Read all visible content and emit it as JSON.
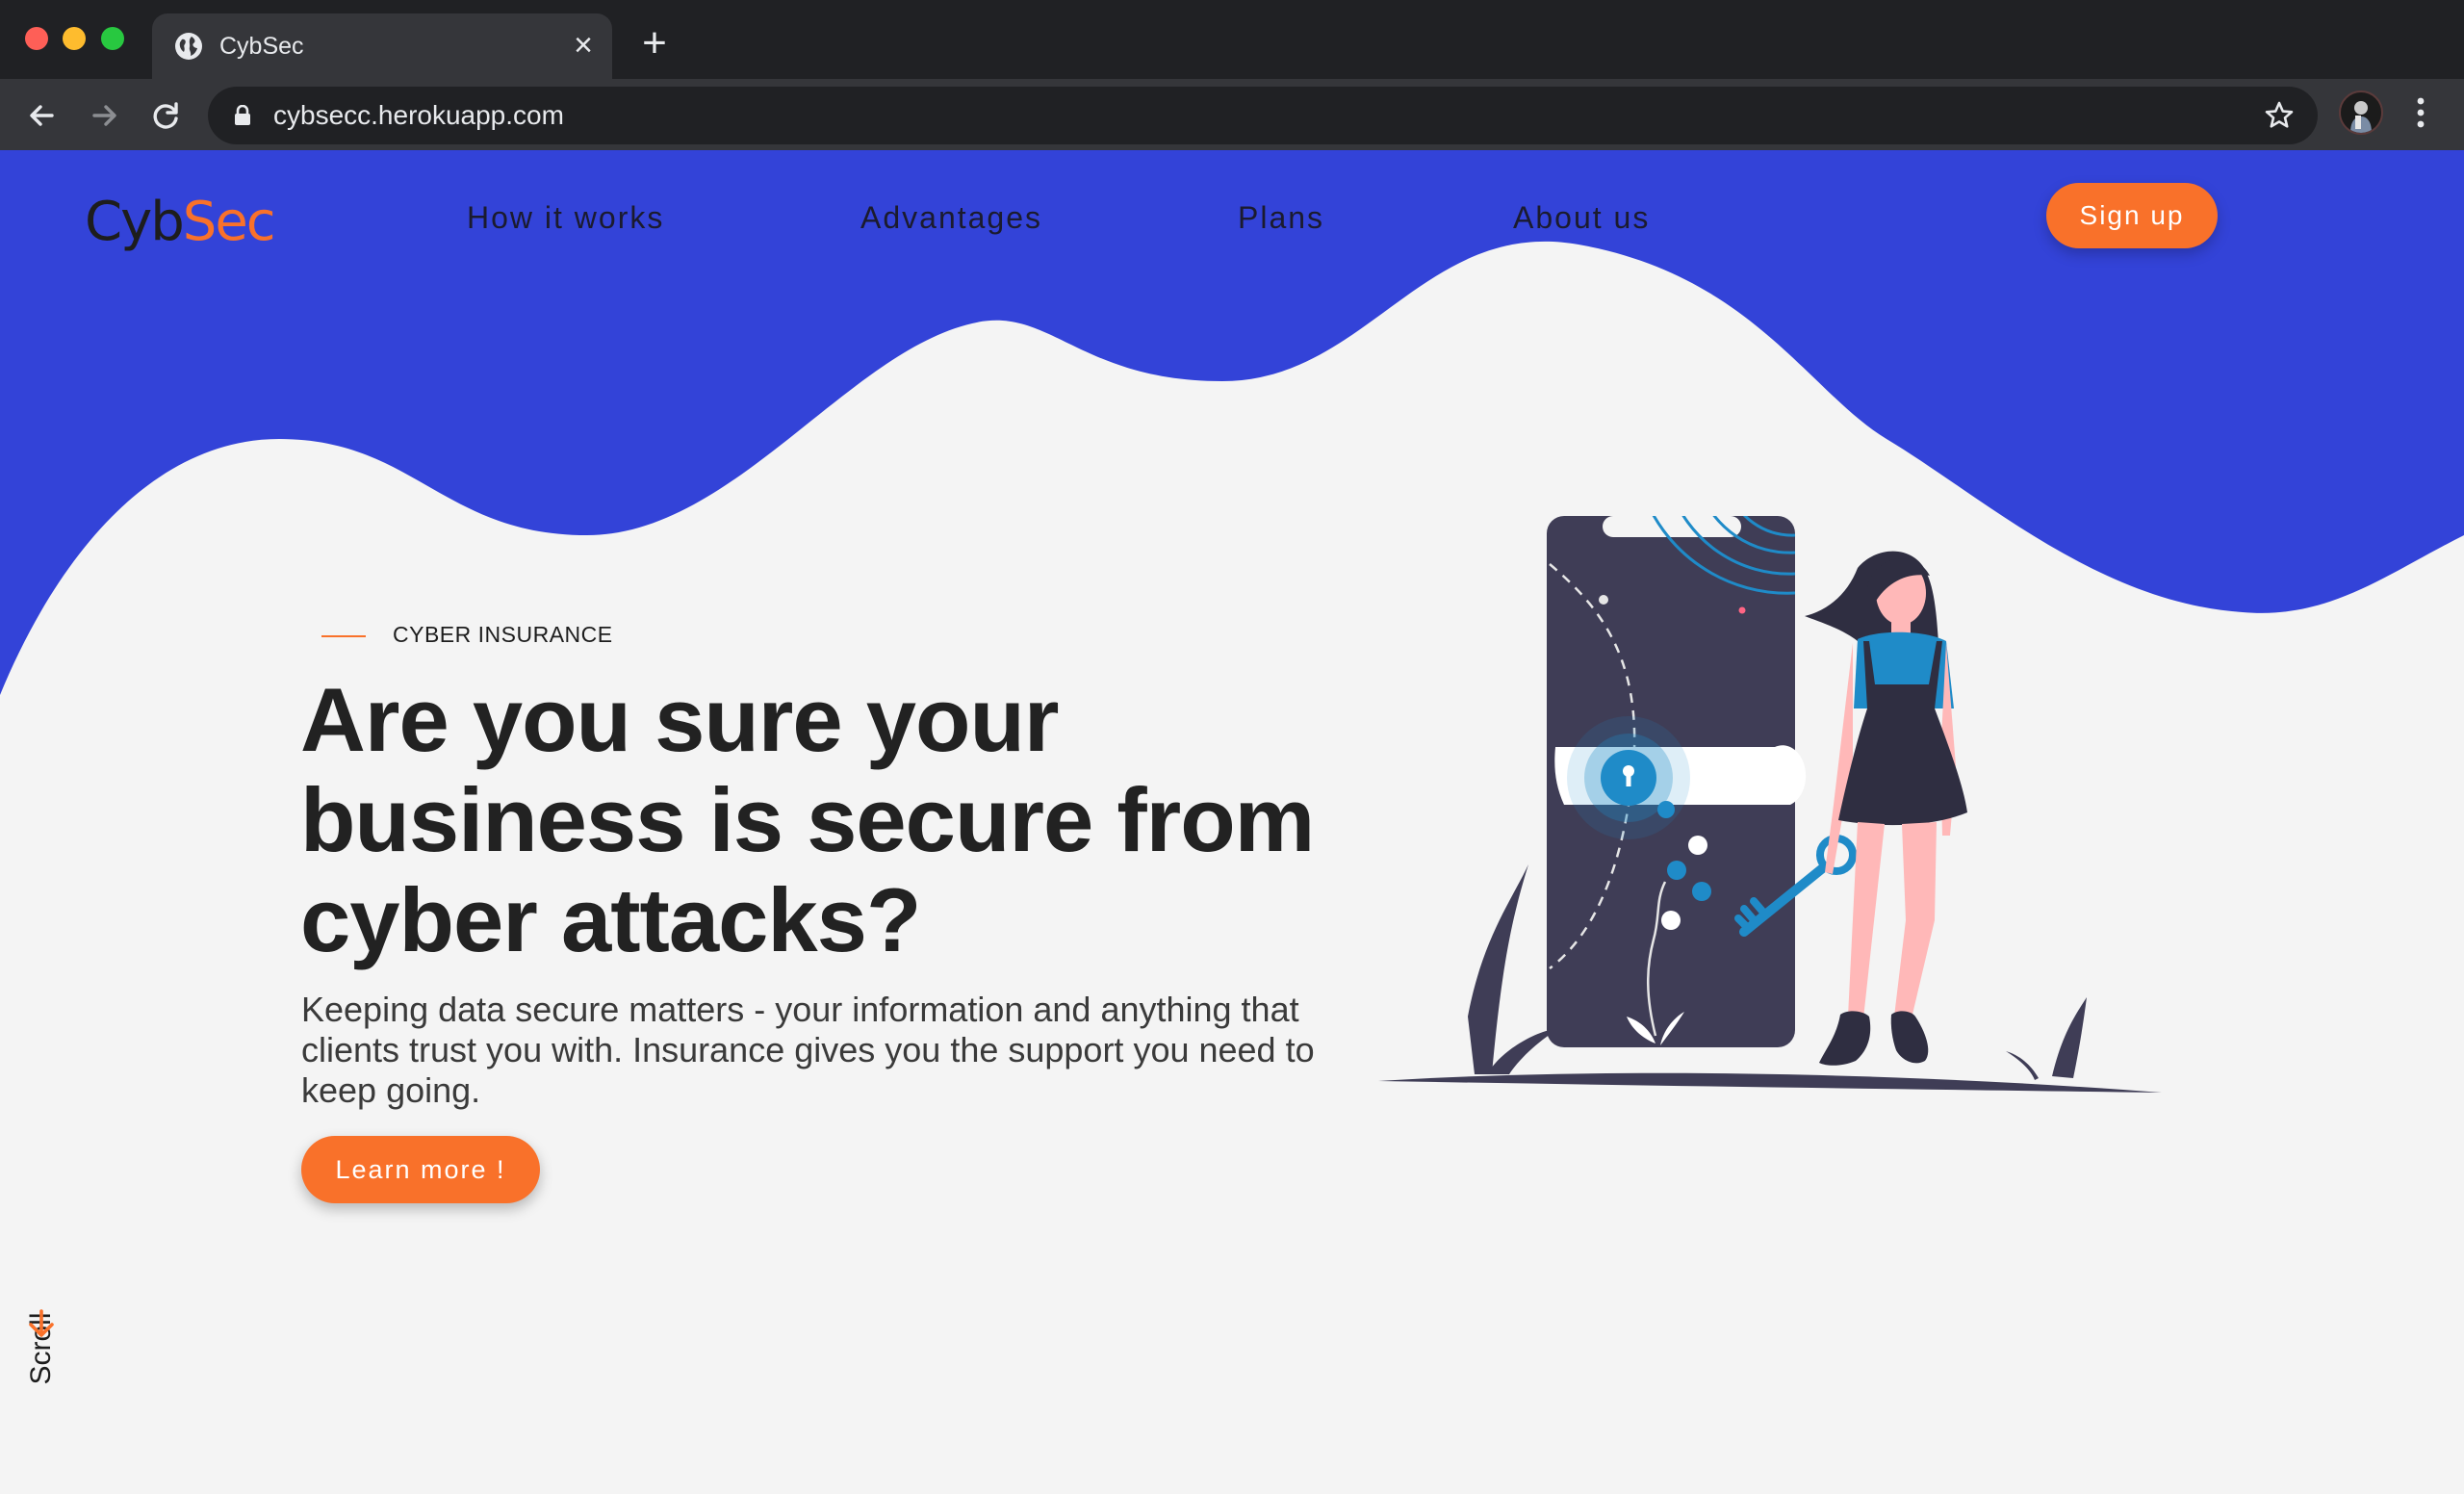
{
  "browser": {
    "tab_title": "CybSec",
    "url": "cybsecc.herokuapp.com",
    "icons": [
      "globe-icon",
      "close-icon",
      "plus-icon",
      "back-arrow-icon",
      "forward-arrow-icon",
      "reload-icon",
      "lock-icon",
      "star-icon",
      "kebab-menu-icon"
    ]
  },
  "header": {
    "logo_primary": "Cyb",
    "logo_accent": "Sec",
    "nav": [
      "How it works",
      "Advantages",
      "Plans",
      "About us"
    ],
    "signup_label": "Sign up"
  },
  "hero": {
    "eyebrow": "CYBER INSURANCE",
    "headline_lines": [
      "Are you sure your",
      "business is secure from",
      "cyber attacks?"
    ],
    "subtext": "Keeping data secure matters - your information and anything that clients trust you with. Insurance gives you the support you need to keep going.",
    "cta_label": "Learn more !"
  },
  "scroll": {
    "label": "Scroll"
  },
  "colors": {
    "brand_blue": "#3343d8",
    "accent_orange": "#f9712a",
    "page_bg": "#f4f4f4",
    "text_dark": "#222222"
  }
}
